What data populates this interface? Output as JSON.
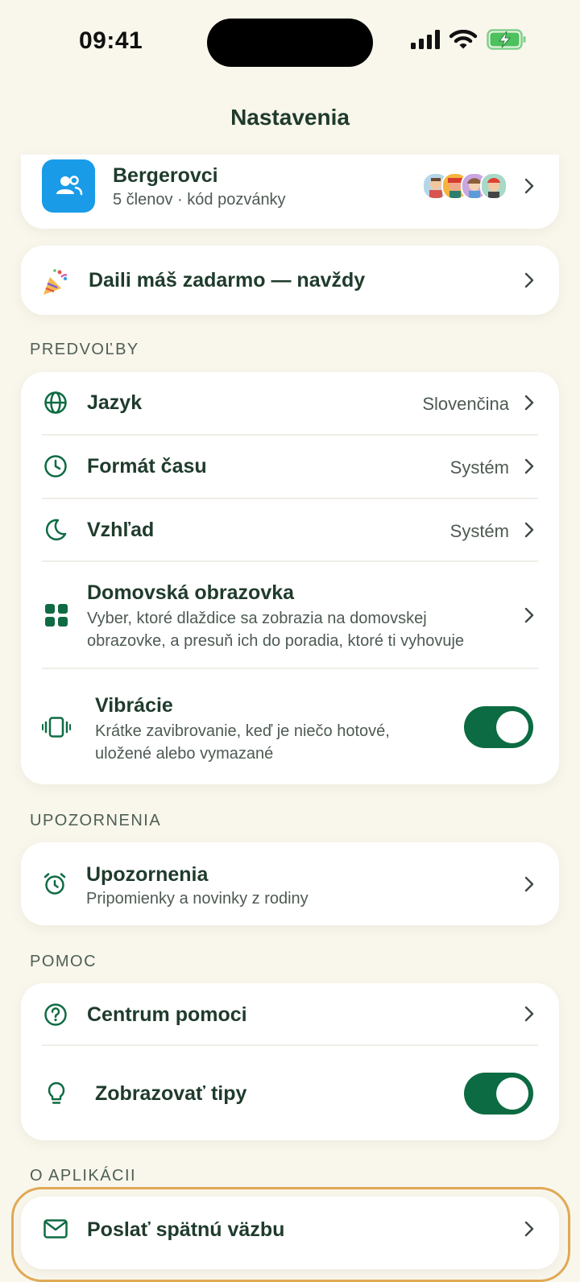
{
  "status_bar": {
    "time": "09:41"
  },
  "header": {
    "title": "Nastavenia"
  },
  "family": {
    "name": "Bergerovci",
    "subtitle": "5 členov · kód pozvánky"
  },
  "promo": {
    "label": "Daili máš zadarmo — navždy"
  },
  "sections": {
    "preferences": "PREDVOĽBY",
    "notifications": "UPOZORNENIA",
    "help": "POMOC",
    "about": "O APLIKÁCII"
  },
  "preferences": {
    "language": {
      "label": "Jazyk",
      "value": "Slovenčina"
    },
    "time_format": {
      "label": "Formát času",
      "value": "Systém"
    },
    "appearance": {
      "label": "Vzhľad",
      "value": "Systém"
    },
    "home_screen": {
      "label": "Domovská obrazovka",
      "desc_line1": "Vyber, ktoré dlaždice sa zobrazia na domovskej",
      "desc_line2": "obrazovke, a presuň ich do poradia, ktoré ti vyhovuje"
    },
    "vibration": {
      "label": "Vibrácie",
      "desc_line1": "Krátke zavibrovanie, keď je niečo hotové,",
      "desc_line2": "uložené alebo vymazané",
      "enabled": true
    }
  },
  "notifications": {
    "label": "Upozornenia",
    "desc": "Pripomienky a novinky z rodiny"
  },
  "help": {
    "help_center": {
      "label": "Centrum pomoci"
    },
    "tips": {
      "label": "Zobrazovať tipy",
      "enabled": true
    }
  },
  "about": {
    "feedback": {
      "label": "Poslať spätnú väzbu"
    }
  },
  "colors": {
    "accent": "#0c6b42",
    "background": "#f9f6ec",
    "family_icon_bg": "#1a9be8",
    "highlight": "#e0a955"
  }
}
